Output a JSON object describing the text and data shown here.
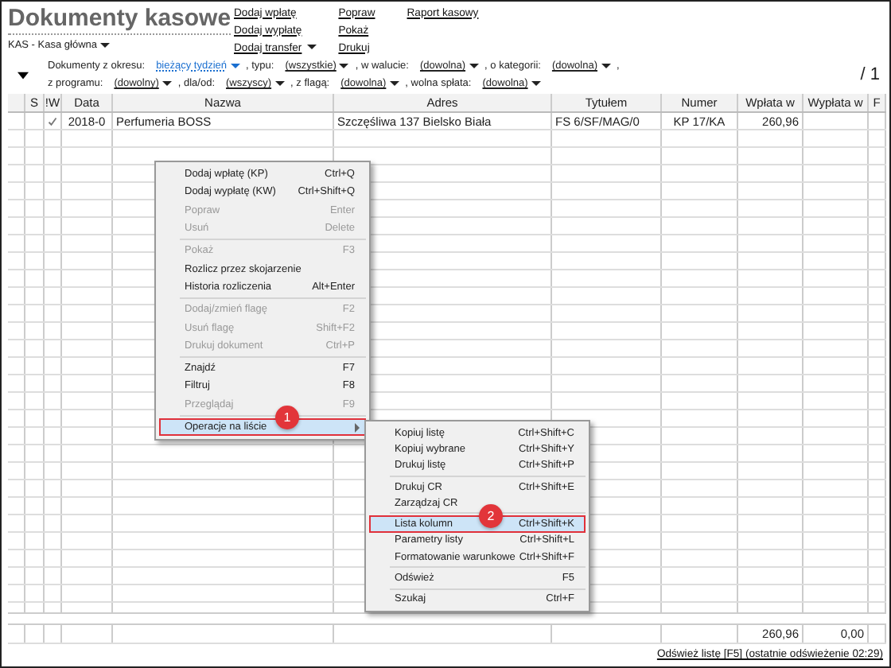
{
  "header": {
    "title": "Dokumenty kasowe",
    "subtitle": "KAS - Kasa główna",
    "link_columns": [
      [
        {
          "label": "Dodaj wpłatę",
          "dropdown": false
        },
        {
          "label": "Dodaj wypłatę",
          "dropdown": false
        },
        {
          "label": "Dodaj transfer",
          "dropdown": true
        }
      ],
      [
        {
          "label": "Popraw",
          "dropdown": false
        },
        {
          "label": "Pokaż",
          "dropdown": false
        },
        {
          "label": "Drukuj",
          "dropdown": false
        }
      ],
      [
        {
          "label": "Raport kasowy",
          "dropdown": false
        }
      ]
    ]
  },
  "filters": [
    [
      {
        "label": "Dokumenty z okresu:",
        "value": "bieżący tydzień",
        "active": true
      },
      {
        "label": ", typu:",
        "value": "(wszystkie)",
        "active": false
      },
      {
        "label": ", w walucie:",
        "value": "(dowolna)",
        "active": false
      },
      {
        "label": ", o kategorii:",
        "value": "(dowolna)",
        "active": false
      },
      {
        "label": ","
      }
    ],
    [
      {
        "label": "z programu:",
        "value": "(dowolny)",
        "active": false
      },
      {
        "label": ", dla/od:",
        "value": "(wszyscy)",
        "active": false
      },
      {
        "label": ", z flagą:",
        "value": "(dowolna)",
        "active": false
      },
      {
        "label": ", wolna spłata:",
        "value": "(dowolna)",
        "active": false
      }
    ]
  ],
  "page": "/ 1",
  "table": {
    "columns": [
      "S",
      "!W",
      "Data",
      "Nazwa",
      "Adres",
      "Tytułem",
      "Numer",
      "Wpłata w",
      "Wypłata w",
      "F"
    ],
    "rows": [
      {
        "checked": true,
        "cells": [
          "",
          "",
          "2018-0",
          "Perfumeria BOSS",
          "Szczęśliwa  137  Bielsko Biała",
          "FS 6/SF/MAG/0",
          "KP 17/KA",
          "260,96",
          "",
          ""
        ]
      }
    ],
    "totals": [
      "260,96",
      "0,00"
    ]
  },
  "refresh_link": "Odśwież listę [F5] (ostatnie odświeżenie 02:29)",
  "context_menu": {
    "groups": [
      [
        {
          "label": "Dodaj wpłatę (KP)",
          "shortcut": "Ctrl+Q",
          "disabled": false,
          "selected": false
        },
        {
          "label": "Dodaj wypłatę (KW)",
          "shortcut": "Ctrl+Shift+Q",
          "disabled": false,
          "selected": false
        },
        {
          "label": "Popraw",
          "shortcut": "Enter",
          "disabled": true,
          "selected": false
        },
        {
          "label": "Usuń",
          "shortcut": "Delete",
          "disabled": true,
          "selected": false
        }
      ],
      [
        {
          "label": "Pokaż",
          "shortcut": "F3",
          "disabled": true,
          "selected": false
        },
        {
          "label": "Rozlicz przez skojarzenie",
          "disabled": false,
          "selected": false
        },
        {
          "label": "Historia rozliczenia",
          "shortcut": "Alt+Enter",
          "disabled": false,
          "selected": false
        }
      ],
      [
        {
          "label": "Dodaj/zmień flagę",
          "shortcut": "F2",
          "disabled": true,
          "selected": false
        },
        {
          "label": "Usuń flagę",
          "shortcut": "Shift+F2",
          "disabled": true,
          "selected": false
        },
        {
          "label": "Drukuj dokument",
          "shortcut": "Ctrl+P",
          "disabled": true,
          "selected": false
        }
      ],
      [
        {
          "label": "Znajdź",
          "shortcut": "F7",
          "disabled": false,
          "selected": false
        },
        {
          "label": "Filtruj",
          "shortcut": "F8",
          "disabled": false,
          "selected": false
        },
        {
          "label": "Przeglądaj",
          "shortcut": "F9",
          "disabled": true,
          "selected": false
        }
      ],
      [
        {
          "label": "Operacje na liście",
          "disabled": false,
          "selected": true,
          "submenu": true
        }
      ]
    ],
    "badge": "1"
  },
  "submenu": {
    "groups": [
      [
        {
          "label": "Kopiuj listę",
          "shortcut": "Ctrl+Shift+C",
          "disabled": false,
          "selected": false
        },
        {
          "label": "Kopiuj wybrane",
          "shortcut": "Ctrl+Shift+Y",
          "disabled": false,
          "selected": false
        },
        {
          "label": "Drukuj listę",
          "shortcut": "Ctrl+Shift+P",
          "disabled": false,
          "selected": false
        }
      ],
      [
        {
          "label": "Drukuj CR",
          "shortcut": "Ctrl+Shift+E",
          "disabled": false,
          "selected": false
        },
        {
          "label": "Zarządzaj CR",
          "disabled": false,
          "selected": false
        }
      ],
      [
        {
          "label": "Lista kolumn",
          "shortcut": "Ctrl+Shift+K",
          "disabled": false,
          "selected": true
        },
        {
          "label": "Parametry listy",
          "shortcut": "Ctrl+Shift+L",
          "disabled": false,
          "selected": false
        },
        {
          "label": "Formatowanie warunkowe",
          "shortcut": "Ctrl+Shift+F",
          "disabled": false,
          "selected": false
        }
      ],
      [
        {
          "label": "Odśwież",
          "shortcut": "F5",
          "disabled": false,
          "selected": false
        }
      ],
      [
        {
          "label": "Szukaj",
          "shortcut": "Ctrl+F",
          "disabled": false,
          "selected": false
        }
      ]
    ],
    "badge": "2"
  }
}
